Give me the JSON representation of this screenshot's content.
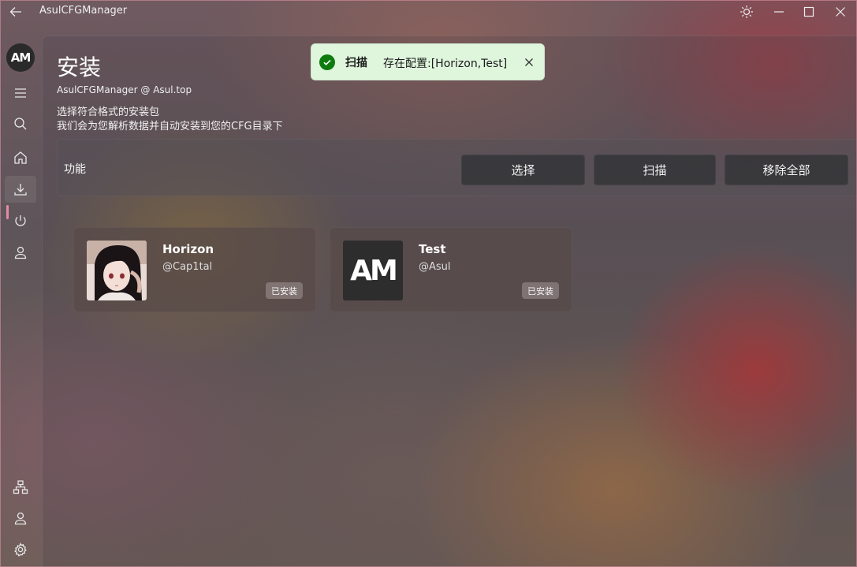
{
  "app": {
    "title": "AsulCFGManager"
  },
  "sidebar": {
    "logo_text": "AM"
  },
  "page": {
    "title": "安装",
    "subtitle": "AsulCFGManager @ Asul.top",
    "desc_line1": "选择符合格式的安装包",
    "desc_line2": "我们会为您解析数据并自动安装到您的CFG目录下"
  },
  "functions": {
    "label": "功能",
    "select_label": "选择",
    "scan_label": "扫描",
    "remove_all_label": "移除全部"
  },
  "configs": [
    {
      "name": "Horizon",
      "author": "@Cap1tal",
      "status": "已安装"
    },
    {
      "name": "Test",
      "author": "@Asul",
      "status": "已安装",
      "logo_text": "AM"
    }
  ],
  "toast": {
    "title": "扫描",
    "message": "存在配置:[Horizon,Test]",
    "accent": "#0f7b0f"
  }
}
